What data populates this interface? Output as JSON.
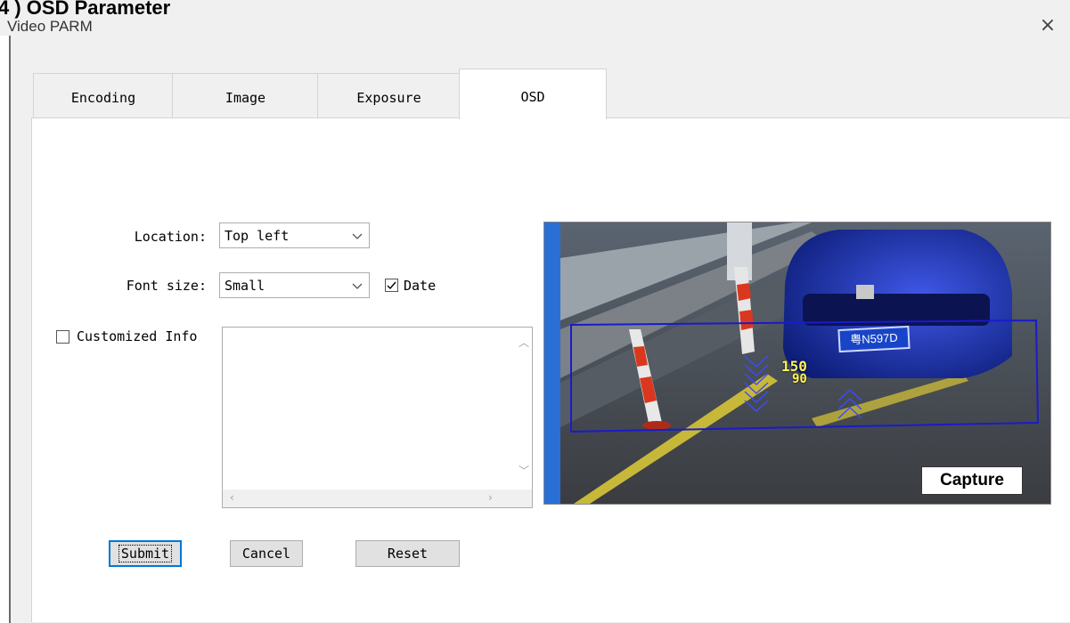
{
  "doc_heading": "4 ) OSD Parameter",
  "window": {
    "title": "Video PARM",
    "close_glyph": "×"
  },
  "tabs": [
    {
      "label": "Encoding",
      "active": false
    },
    {
      "label": "Image",
      "active": false
    },
    {
      "label": "Exposure",
      "active": false
    },
    {
      "label": "OSD",
      "active": true
    }
  ],
  "form": {
    "location_label": "Location:",
    "location_value": "Top left",
    "font_size_label": "Font size:",
    "font_size_value": "Small",
    "date_label": "Date",
    "date_checked": true,
    "customized_label": "Customized Info",
    "customized_checked": false,
    "customized_text": ""
  },
  "buttons": {
    "submit": "Submit",
    "cancel": "Cancel",
    "reset": "Reset"
  },
  "preview": {
    "capture_label": "Capture",
    "plate_text": "粤N597D",
    "speed_top": "150",
    "speed_bottom": "90"
  },
  "colors": {
    "accent": "#0078d7",
    "roi_box": "#1a1acc",
    "osd_text": "#fff45a"
  }
}
